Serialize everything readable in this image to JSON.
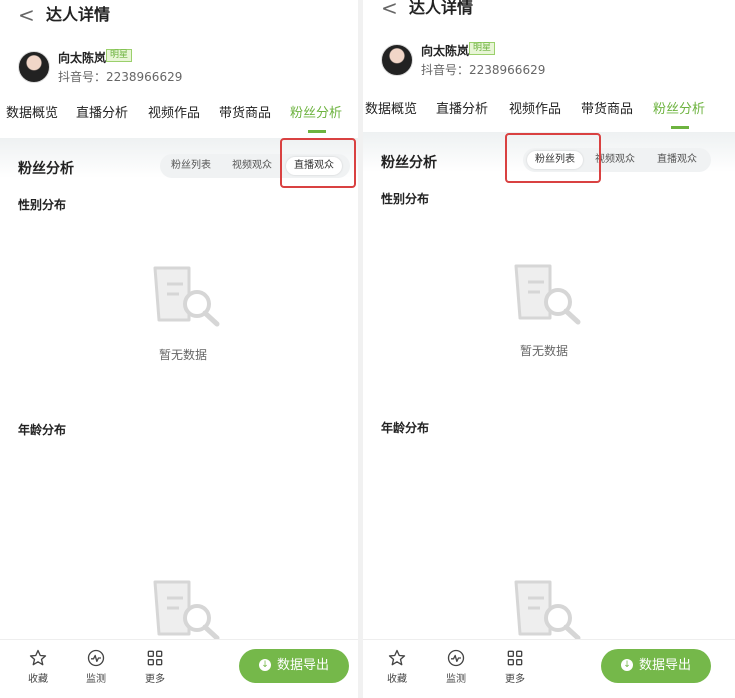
{
  "header": {
    "title": "达人详情"
  },
  "profile": {
    "name": "向太陈岚",
    "badge": "明星",
    "douyin_id": "抖音号：2238966629"
  },
  "tabs": [
    "数据概览",
    "直播分析",
    "视频作品",
    "带货商品",
    "粉丝分析"
  ],
  "active_tab": "粉丝分析",
  "fan_section": {
    "title": "粉丝分析",
    "segments": [
      "粉丝列表",
      "视频观众",
      "直播观众"
    ],
    "gender_label": "性别分布",
    "age_label": "年龄分布",
    "empty_text": "暂无数据"
  },
  "panels": [
    {
      "selected_segment": "直播观众"
    },
    {
      "selected_segment": "粉丝列表"
    }
  ],
  "bottom_bar": {
    "favorite": "收藏",
    "monitor": "监测",
    "more": "更多",
    "export": "数据导出"
  },
  "colors": {
    "accent": "#6db33f",
    "highlight": "#d94141",
    "button": "#75b84a"
  },
  "icons": [
    "back-arrow-icon",
    "star-icon",
    "pulse-icon",
    "grid-icon",
    "download-icon",
    "empty-data-icon"
  ]
}
